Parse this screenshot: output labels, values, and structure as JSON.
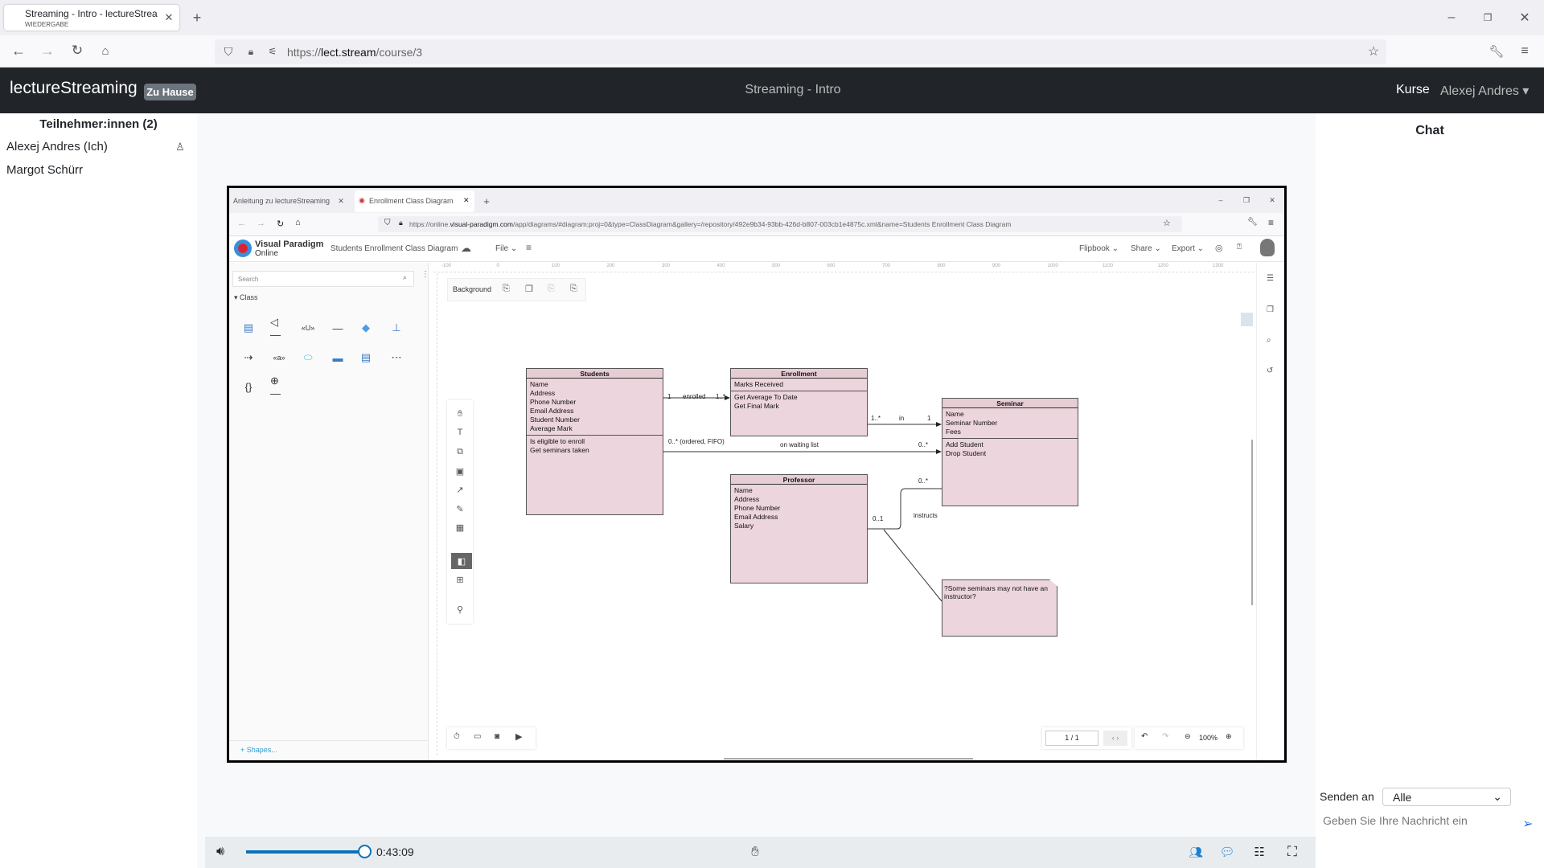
{
  "browser": {
    "tab_title": "Streaming - Intro - lectureStreaming",
    "tab_subtitle": "WIEDERGABE",
    "url_prefix": "https://",
    "url_host": "lect.stream",
    "url_path": "/course/3"
  },
  "app": {
    "brand": "lectureStreaming",
    "badge": "Zu Hause",
    "title": "Streaming - Intro",
    "nav_courses": "Kurse",
    "user": "Alexej Andres"
  },
  "participants": {
    "header": "Teilnehmer:innen (2)",
    "items": [
      {
        "name": "Alexej Andres (Ich)",
        "icon": "presenter-icon"
      },
      {
        "name": "Margot Schürr"
      }
    ]
  },
  "chat": {
    "title": "Chat",
    "send_to_label": "Senden an",
    "send_to_value": "Alle",
    "placeholder": "Geben Sie Ihre Nachricht ein"
  },
  "player": {
    "time": "0:43:09",
    "volume": 1.0
  },
  "inner": {
    "tabs": [
      {
        "label": "Anleitung zu lectureStreaming"
      },
      {
        "label": "Enrollment Class Diagram"
      }
    ],
    "url_prefix": "https://online.",
    "url_host": "visual-paradigm.com",
    "url_path": "/app/diagrams/#diagram:proj=0&type=ClassDiagram&gallery=/repository/492e9b34-93bb-426d-b807-003cb1e4875c.xml&name=Students Enrollment Class Diagram",
    "logo_line1": "Visual Paradigm",
    "logo_line2": "Online",
    "doc_title": "Students Enrollment Class Diagram",
    "menu": {
      "file": "File",
      "flipbook": "Flipbook",
      "share": "Share",
      "export": "Export"
    },
    "search_placeholder": "Search",
    "category": "Class",
    "shapes_link": "+ Shapes...",
    "background_label": "Background",
    "ruler_h": [
      "-100",
      "0",
      "100",
      "200",
      "300",
      "400",
      "500",
      "600",
      "700",
      "800",
      "900",
      "1000",
      "1100",
      "1200",
      "1300"
    ],
    "page": "1 / 1",
    "zoom": "100%",
    "classes": {
      "students": {
        "name": "Students",
        "attrs": [
          "Name",
          "Address",
          "Phone Number",
          "Email Address",
          "Student Number",
          "Average Mark"
        ],
        "ops": [
          "Is eligible to enroll",
          "Get seminars taken"
        ]
      },
      "enrollment": {
        "name": "Enrollment",
        "attrs": [
          "Marks Received"
        ],
        "ops": [
          "Get Average To Date",
          "Get Final Mark"
        ]
      },
      "seminar": {
        "name": "Seminar",
        "attrs": [
          "Name",
          "Seminar Number",
          "Fees"
        ],
        "ops": [
          "Add Student",
          "Drop Student"
        ]
      },
      "professor": {
        "name": "Professor",
        "attrs": [
          "Name",
          "Address",
          "Phone Number",
          "Email Address",
          "Salary"
        ]
      }
    },
    "note": "?Some seminars may not have an instructor?",
    "assoc": {
      "enrolled": {
        "src": "1",
        "label": "enrolled",
        "dst": "1..*"
      },
      "in": {
        "src": "1..*",
        "label": "in",
        "dst": "1"
      },
      "waiting": {
        "src": "0..* (ordered, FIFO)",
        "label": "on waiting list",
        "dst": "0..*"
      },
      "instructs": {
        "src": "0..1",
        "label": "instructs",
        "dst": "0..*"
      }
    }
  }
}
